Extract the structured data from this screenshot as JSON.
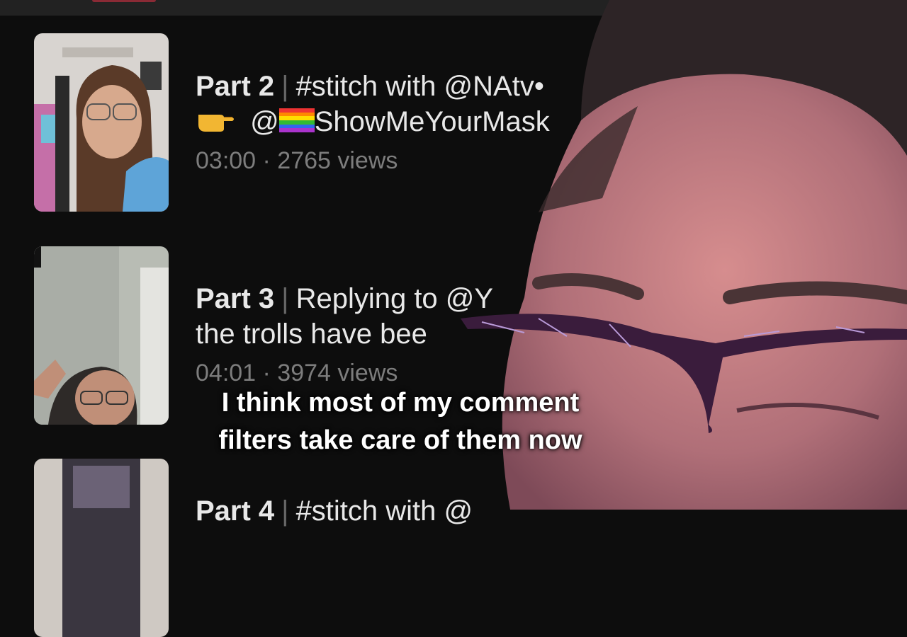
{
  "items": [
    {
      "part": "Part 2",
      "title": "#stitch with @NAtv•",
      "line2_prefix": "@",
      "line2_text": "ShowMeYourMask",
      "meta": "03:00 · 2765 views"
    },
    {
      "part": "Part 3",
      "title": "Replying to @Y",
      "line2_text": "the trolls have bee",
      "meta": "04:01 · 3974 views"
    },
    {
      "part": "Part 4",
      "title": "#stitch with @"
    }
  ],
  "caption": {
    "line1": "I think most of my comment",
    "line2": "filters take care of them now"
  },
  "colors": {
    "background": "#0d0d0d",
    "title": "#e8e8e8",
    "meta": "#7d7d7d"
  },
  "icons": [
    "pointing-hand-icon",
    "rainbow-flag-icon"
  ]
}
